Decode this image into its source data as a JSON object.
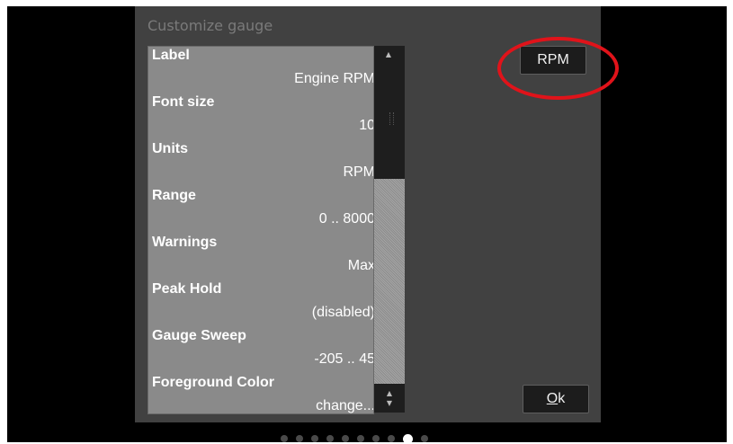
{
  "dialog": {
    "title": "Customize gauge"
  },
  "settings": [
    {
      "label": "Label",
      "value": "Engine RPM"
    },
    {
      "label": "Font size",
      "value": "10"
    },
    {
      "label": "Units",
      "value": "RPM"
    },
    {
      "label": "Range",
      "value": "0 .. 8000"
    },
    {
      "label": "Warnings",
      "value": "Max"
    },
    {
      "label": "Peak Hold",
      "value": "(disabled)"
    },
    {
      "label": "Gauge Sweep",
      "value": "-205 .. 45"
    },
    {
      "label": "Foreground Color",
      "value": "change..."
    }
  ],
  "buttons": {
    "preview_label": "RPM",
    "ok_label_prefix": "",
    "ok_label_underlined": "O",
    "ok_label_rest": "k"
  },
  "scrollbar": {
    "up_icon": "triangle-up",
    "down_icon": "triangle-down"
  },
  "annotation": {
    "color": "#e0131a"
  },
  "pager": {
    "count": 10,
    "active_index": 8
  }
}
